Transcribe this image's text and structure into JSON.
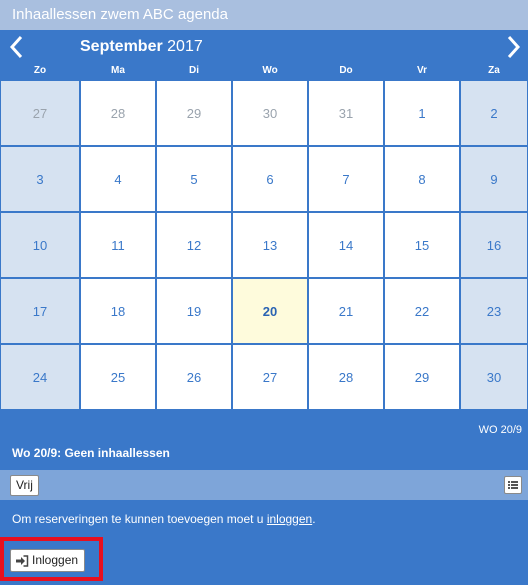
{
  "title": "Inhaallessen zwem ABC agenda",
  "calendar": {
    "month": "September",
    "year": "2017",
    "day_names": [
      "Zo",
      "Ma",
      "Di",
      "Wo",
      "Do",
      "Vr",
      "Za"
    ],
    "weeks": [
      [
        "27",
        "28",
        "29",
        "30",
        "31",
        "1",
        "2"
      ],
      [
        "3",
        "4",
        "5",
        "6",
        "7",
        "8",
        "9"
      ],
      [
        "10",
        "11",
        "12",
        "13",
        "14",
        "15",
        "16"
      ],
      [
        "17",
        "18",
        "19",
        "20",
        "21",
        "22",
        "23"
      ],
      [
        "24",
        "25",
        "26",
        "27",
        "28",
        "29",
        "30"
      ]
    ],
    "selected_day": "20"
  },
  "info": {
    "date_short": "WO 20/9",
    "message": "Wo 20/9: Geen inhaallessen"
  },
  "toolbar": {
    "vrij_label": "Vrij"
  },
  "notice": {
    "text": "Om reserveringen te kunnen toevoegen moet u ",
    "link": "inloggen",
    "suffix": "."
  },
  "login_button": {
    "label": "Inloggen"
  },
  "colors": {
    "primary": "#3a78c9",
    "weekend": "#d6e2f1",
    "today": "#fefbdc",
    "highlight": "#e8101f"
  }
}
